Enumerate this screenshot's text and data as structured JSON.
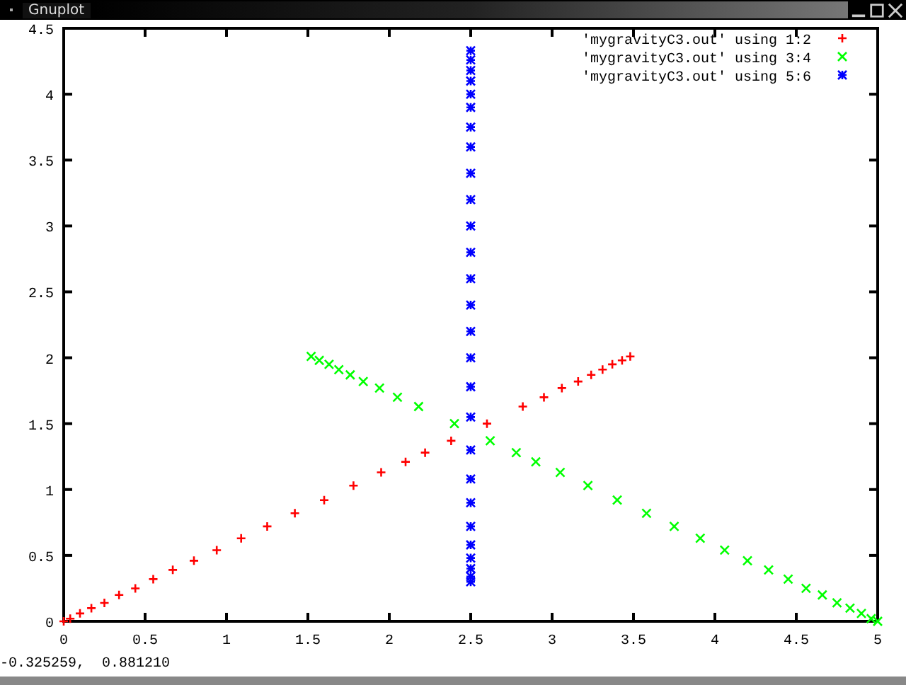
{
  "window": {
    "title": "Gnuplot"
  },
  "plot": {
    "chart_data": {
      "type": "scatter",
      "legend": true,
      "xlim": [
        0,
        5
      ],
      "ylim": [
        0,
        4.5
      ],
      "xticks": [
        {
          "value": 0,
          "label": "0"
        },
        {
          "value": 0.5,
          "label": "0.5"
        },
        {
          "value": 1,
          "label": "1"
        },
        {
          "value": 1.5,
          "label": "1.5"
        },
        {
          "value": 2,
          "label": "2"
        },
        {
          "value": 2.5,
          "label": "2.5"
        },
        {
          "value": 3,
          "label": "3"
        },
        {
          "value": 3.5,
          "label": "3.5"
        },
        {
          "value": 4,
          "label": "4"
        },
        {
          "value": 4.5,
          "label": "4.5"
        },
        {
          "value": 5,
          "label": "5"
        }
      ],
      "yticks": [
        {
          "value": 0,
          "label": "0"
        },
        {
          "value": 0.5,
          "label": "0.5"
        },
        {
          "value": 1,
          "label": "1"
        },
        {
          "value": 1.5,
          "label": "1.5"
        },
        {
          "value": 2,
          "label": "2"
        },
        {
          "value": 2.5,
          "label": "2.5"
        },
        {
          "value": 3,
          "label": "3"
        },
        {
          "value": 3.5,
          "label": "3.5"
        },
        {
          "value": 4,
          "label": "4"
        },
        {
          "value": 4.5,
          "label": "4.5"
        }
      ],
      "series": [
        {
          "name": "'mygravityC3.out' using 1:2",
          "color": "#ff0000",
          "x": [
            0,
            0.04,
            0.1,
            0.17,
            0.25,
            0.34,
            0.44,
            0.55,
            0.67,
            0.8,
            0.94,
            1.09,
            1.25,
            1.42,
            1.6,
            1.78,
            1.95,
            2.1,
            2.22,
            2.38,
            2.6,
            2.82,
            2.95,
            3.06,
            3.16,
            3.24,
            3.31,
            3.37,
            3.43,
            3.48
          ],
          "values": [
            0,
            0.02,
            0.06,
            0.1,
            0.14,
            0.2,
            0.25,
            0.32,
            0.39,
            0.46,
            0.54,
            0.63,
            0.72,
            0.82,
            0.92,
            1.03,
            1.13,
            1.21,
            1.28,
            1.37,
            1.5,
            1.63,
            1.7,
            1.77,
            1.82,
            1.87,
            1.91,
            1.95,
            1.98,
            2.01
          ]
        },
        {
          "name": "'mygravityC3.out' using 3:4",
          "color": "#00ff00",
          "x": [
            1.52,
            1.57,
            1.63,
            1.69,
            1.76,
            1.84,
            1.94,
            2.05,
            2.18,
            2.4,
            2.62,
            2.78,
            2.9,
            3.05,
            3.22,
            3.4,
            3.58,
            3.75,
            3.91,
            4.06,
            4.2,
            4.33,
            4.45,
            4.56,
            4.66,
            4.75,
            4.83,
            4.9,
            4.96,
            5
          ],
          "values": [
            2.01,
            1.98,
            1.95,
            1.91,
            1.87,
            1.82,
            1.77,
            1.7,
            1.63,
            1.5,
            1.37,
            1.28,
            1.21,
            1.13,
            1.03,
            0.92,
            0.82,
            0.72,
            0.63,
            0.54,
            0.46,
            0.39,
            0.32,
            0.25,
            0.2,
            0.14,
            0.1,
            0.06,
            0.02,
            0
          ]
        },
        {
          "name": "'mygravityC3.out' using 5:6",
          "color": "#0000ff",
          "x": [
            2.5,
            2.5,
            2.5,
            2.5,
            2.5,
            2.5,
            2.5,
            2.5,
            2.5,
            2.5,
            2.5,
            2.5,
            2.5,
            2.5,
            2.5,
            2.5,
            2.5,
            2.5,
            2.5,
            2.5,
            2.5,
            2.5,
            2.5,
            2.5,
            2.5,
            2.5,
            2.5
          ],
          "values": [
            0.3,
            0.34,
            0.4,
            0.48,
            0.58,
            0.72,
            0.9,
            1.08,
            1.3,
            1.55,
            1.78,
            2.0,
            2.2,
            2.4,
            2.6,
            2.8,
            3.0,
            3.2,
            3.4,
            3.6,
            3.75,
            3.9,
            4.0,
            4.1,
            4.18,
            4.26,
            4.33
          ]
        }
      ]
    }
  },
  "status_bar": {
    "coordinates": "-0.325259,  0.881210"
  }
}
